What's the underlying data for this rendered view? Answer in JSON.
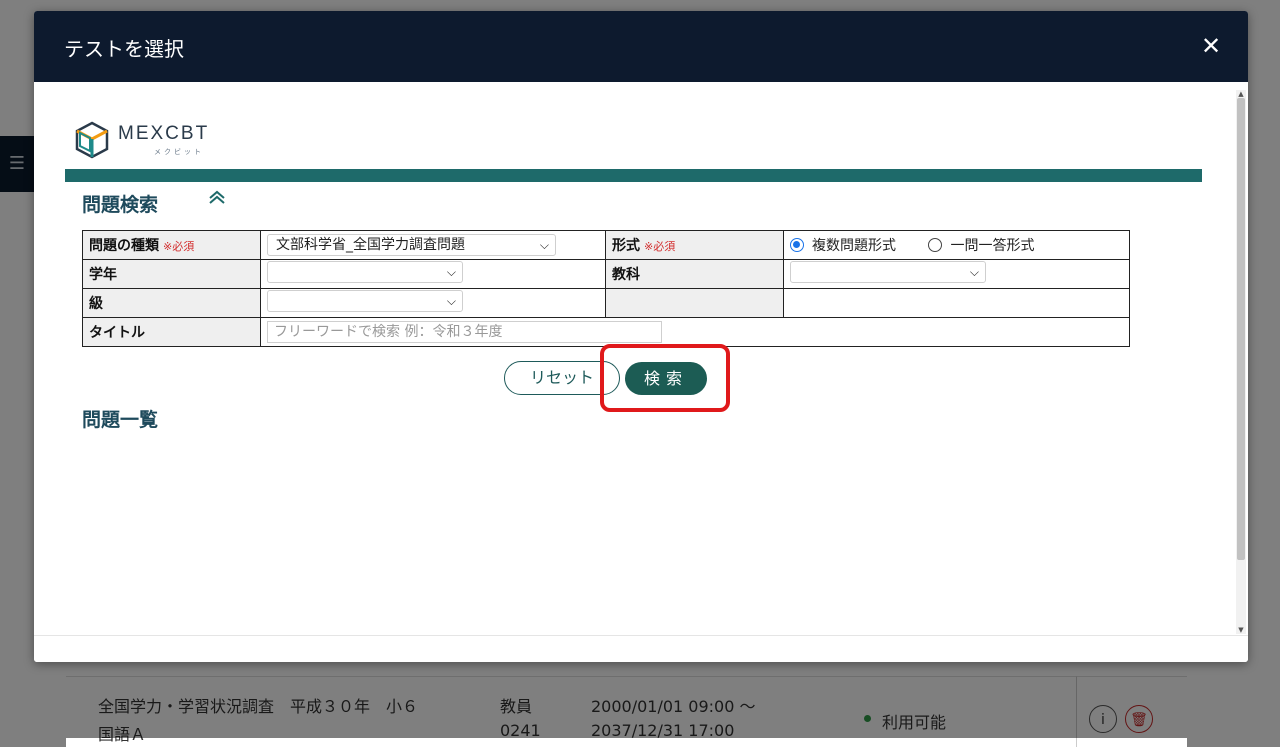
{
  "modal": {
    "title": "テストを選択",
    "close_icon": "close-icon"
  },
  "logo": {
    "name": "MEXCBT",
    "sub": "メクビット"
  },
  "search_section": {
    "title": "問題検索",
    "collapse_icon": "double-chevron-up-icon",
    "required_mark": "※必須",
    "rows": {
      "problem_type": {
        "label": "問題の種類",
        "value": "文部科学省_全国学力調査問題"
      },
      "format": {
        "label": "形式",
        "options": [
          "複数問題形式",
          "一問一答形式"
        ],
        "selected": "複数問題形式"
      },
      "grade": {
        "label": "学年",
        "value": ""
      },
      "subject": {
        "label": "教科",
        "value": ""
      },
      "level": {
        "label": "級",
        "value": ""
      },
      "title": {
        "label": "タイトル",
        "placeholder": "フリーワードで検索 例：令和３年度"
      }
    },
    "reset_label": "リセット",
    "search_label": "検索"
  },
  "list_section": {
    "title": "問題一覧"
  },
  "background_row": {
    "col1_line1": "全国学力・学習状況調査　平成３０年　小６",
    "col1_line2": "国語Ａ",
    "col2_line1": "教員",
    "col2_line2": "0241",
    "col3_line1": "2000/01/01 09:00 ～",
    "col3_line2": "2037/12/31 17:00",
    "status": "利用可能",
    "info_icon": "i",
    "status_color": "#2e9b47"
  },
  "colors": {
    "header": "#0d1a2e",
    "accent": "#1e6a6a",
    "search_button": "#1c5c54",
    "highlight": "#e0191b",
    "required": "#d32f2f",
    "radio_selected": "#1a73e8"
  }
}
